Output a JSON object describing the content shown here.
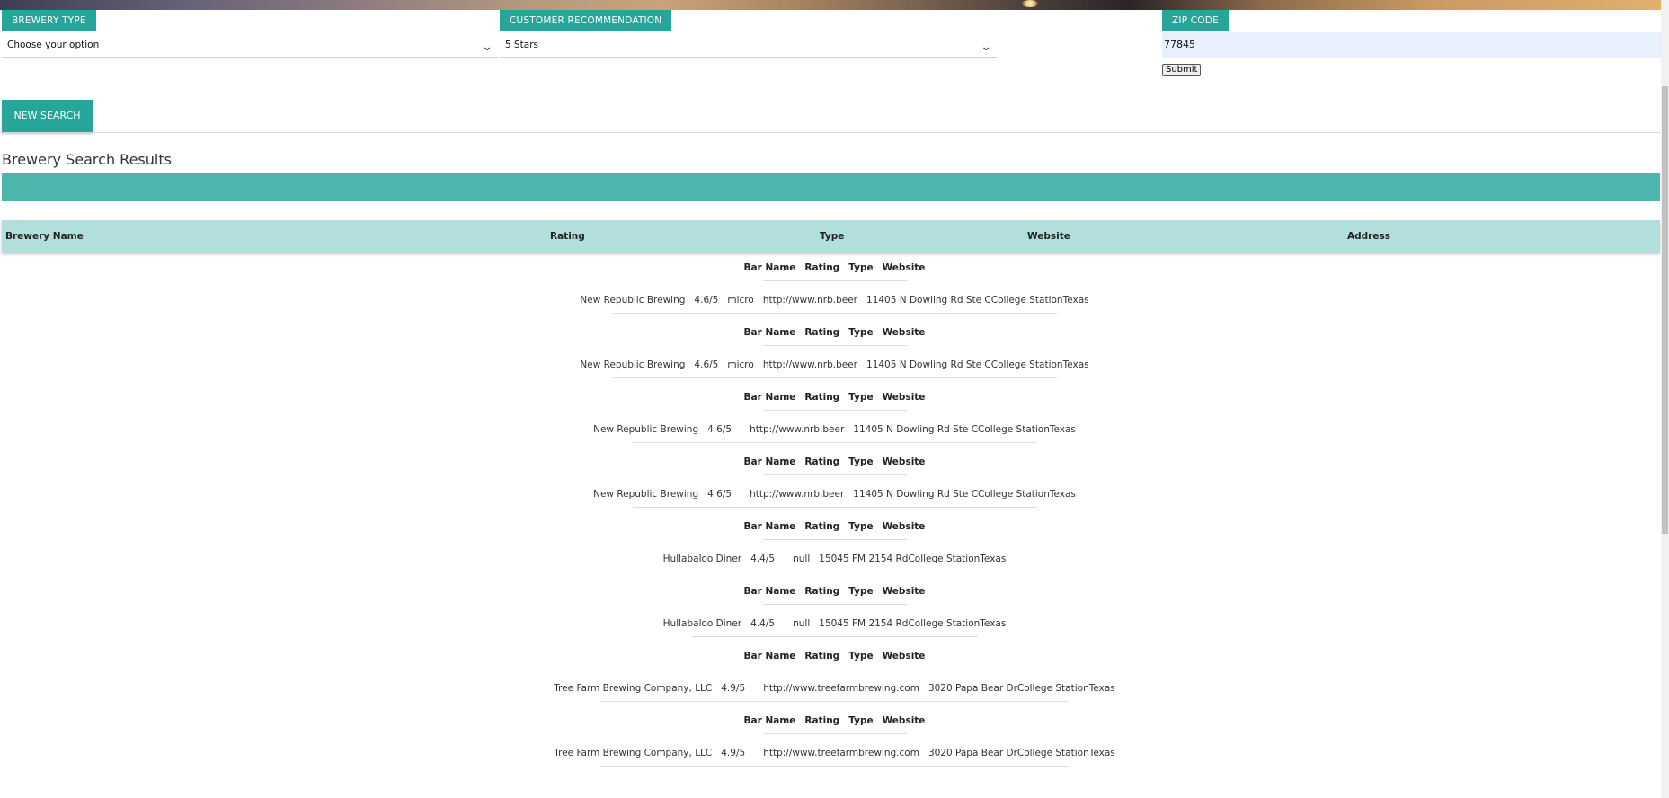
{
  "filters": {
    "brewery_type_label": "BREWERY TYPE",
    "brewery_type_value": "Choose your option",
    "recommendation_label": "CUSTOMER RECOMMENDATION",
    "recommendation_value": "5 Stars",
    "zip_label": "ZIP CODE",
    "zip_value": "77845",
    "submit_label": "Submit"
  },
  "new_search_label": "NEW SEARCH",
  "results_title": "Brewery Search Results",
  "table_headers": [
    "Brewery Name",
    "Rating",
    "Type",
    "Website",
    "Address"
  ],
  "mini_headers": [
    "Bar Name",
    "Rating",
    "Type",
    "Website"
  ],
  "results": [
    {
      "name": "New Republic Brewing",
      "rating": "4.6/5",
      "type": "micro",
      "website": "http://www.nrb.beer",
      "address": "11405 N Dowling Rd Ste CCollege StationTexas"
    },
    {
      "name": "New Republic Brewing",
      "rating": "4.6/5",
      "type": "micro",
      "website": "http://www.nrb.beer",
      "address": "11405 N Dowling Rd Ste CCollege StationTexas"
    },
    {
      "name": "New Republic Brewing",
      "rating": "4.6/5",
      "type": "",
      "website": "http://www.nrb.beer",
      "address": "11405 N Dowling Rd Ste CCollege StationTexas"
    },
    {
      "name": "New Republic Brewing",
      "rating": "4.6/5",
      "type": "",
      "website": "http://www.nrb.beer",
      "address": "11405 N Dowling Rd Ste CCollege StationTexas"
    },
    {
      "name": "Hullabaloo Diner",
      "rating": "4.4/5",
      "type": "",
      "website": "null",
      "address": "15045 FM 2154 RdCollege StationTexas"
    },
    {
      "name": "Hullabaloo Diner",
      "rating": "4.4/5",
      "type": "",
      "website": "null",
      "address": "15045 FM 2154 RdCollege StationTexas"
    },
    {
      "name": "Tree Farm Brewing Company, LLC",
      "rating": "4.9/5",
      "type": "",
      "website": "http://www.treefarmbrewing.com",
      "address": "3020 Papa Bear DrCollege StationTexas"
    },
    {
      "name": "Tree Farm Brewing Company, LLC",
      "rating": "4.9/5",
      "type": "",
      "website": "http://www.treefarmbrewing.com",
      "address": "3020 Papa Bear DrCollege StationTexas"
    }
  ]
}
